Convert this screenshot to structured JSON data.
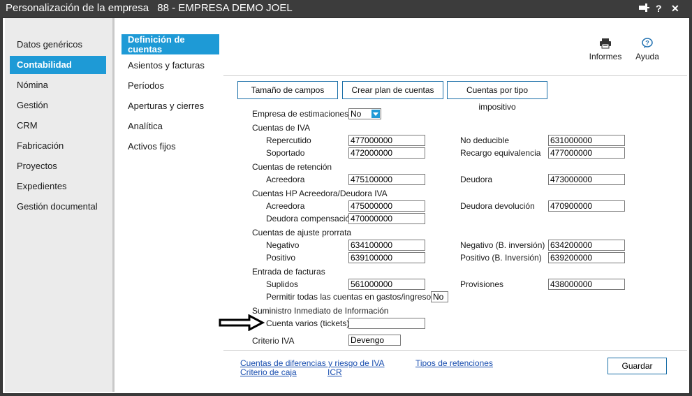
{
  "window": {
    "title": "Personalización de la empresa",
    "company": "88 - EMPRESA DEMO JOEL"
  },
  "nav_primary": [
    {
      "label": "Datos genéricos"
    },
    {
      "label": "Contabilidad"
    },
    {
      "label": "Nómina"
    },
    {
      "label": "Gestión"
    },
    {
      "label": "CRM"
    },
    {
      "label": "Fabricación"
    },
    {
      "label": "Proyectos"
    },
    {
      "label": "Expedientes"
    },
    {
      "label": "Gestión documental"
    }
  ],
  "nav_secondary": [
    {
      "label": "Definición de cuentas"
    },
    {
      "label": "Asientos y facturas"
    },
    {
      "label": "Períodos"
    },
    {
      "label": "Aperturas y cierres"
    },
    {
      "label": "Analítica"
    },
    {
      "label": "Activos fijos"
    }
  ],
  "toolbar": {
    "reports_label": "Informes",
    "help_label": "Ayuda"
  },
  "buttons": {
    "field_size": "Tamaño de campos",
    "create_plan": "Crear plan de cuentas",
    "by_tax_type": "Cuentas por tipo impositivo",
    "save": "Guardar"
  },
  "form": {
    "empresa_estimaciones": {
      "label": "Empresa de estimaciones",
      "value": "No"
    },
    "iva": {
      "section": "Cuentas de IVA",
      "repercutido": {
        "label": "Repercutido",
        "value": "477000000"
      },
      "soportado": {
        "label": "Soportado",
        "value": "472000000"
      },
      "no_deducible": {
        "label": "No deducible",
        "value": "631000000"
      },
      "recargo": {
        "label": "Recargo equivalencia",
        "value": "477000000"
      }
    },
    "retencion": {
      "section": "Cuentas de retención",
      "acreedora": {
        "label": "Acreedora",
        "value": "475100000"
      },
      "deudora": {
        "label": "Deudora",
        "value": "473000000"
      }
    },
    "hp": {
      "section": "Cuentas HP Acreedora/Deudora IVA",
      "acreedora": {
        "label": "Acreedora",
        "value": "475000000"
      },
      "deudora_devolucion": {
        "label": "Deudora devolución",
        "value": "470900000"
      },
      "deudora_compensacion": {
        "label": "Deudora compensación",
        "value": "470000000"
      }
    },
    "prorrata": {
      "section": "Cuentas de ajuste prorrata",
      "negativo": {
        "label": "Negativo",
        "value": "634100000"
      },
      "positivo": {
        "label": "Positivo",
        "value": "639100000"
      },
      "negativo_inv": {
        "label": "Negativo (B. inversión)",
        "value": "634200000"
      },
      "positivo_inv": {
        "label": "Positivo (B. Inversión)",
        "value": "639200000"
      }
    },
    "facturas": {
      "section": "Entrada de facturas",
      "suplidos": {
        "label": "Suplidos",
        "value": "561000000"
      },
      "provisiones": {
        "label": "Provisiones",
        "value": "438000000"
      },
      "permitir": {
        "label": "Permitir todas las cuentas en gastos/ingresos",
        "value": "No"
      }
    },
    "sii": {
      "section": "Suministro Inmediato de Información",
      "cuenta_varios": {
        "label": "Cuenta varios (tickets)",
        "value": ""
      }
    },
    "criterio_iva": {
      "label": "Criterio IVA",
      "value": "Devengo"
    }
  },
  "links": {
    "diferencias": "Cuentas de diferencias y riesgo de IVA",
    "criterio_caja": "Criterio de caja",
    "icr": "ICR",
    "tipos_retenciones": "Tipos de retenciones"
  }
}
